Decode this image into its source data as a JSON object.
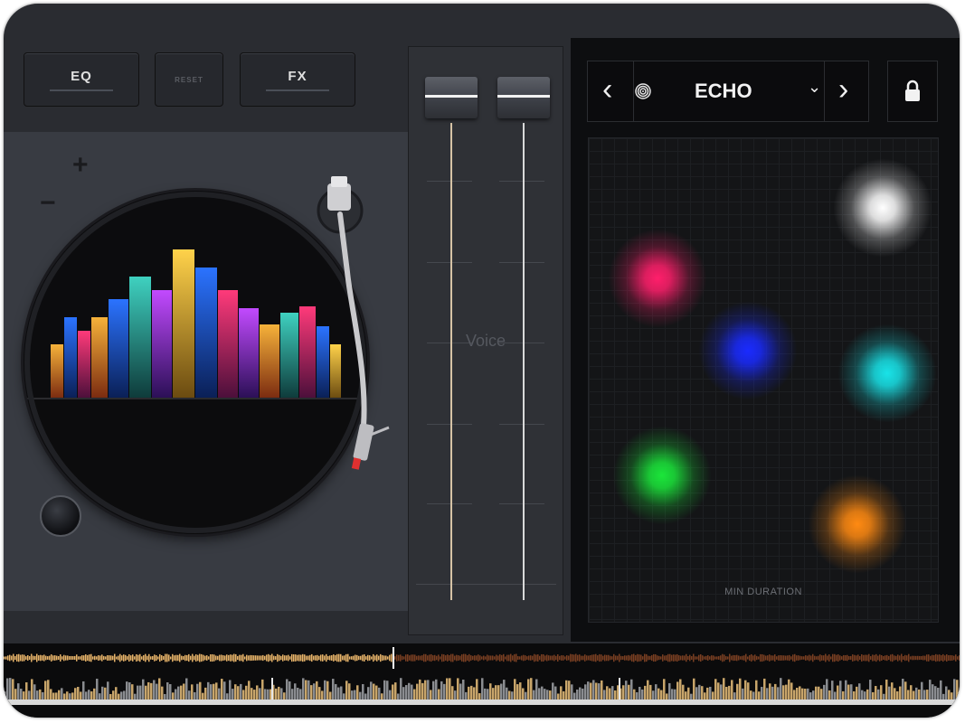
{
  "toolbar": {
    "eq_label": "EQ",
    "reset_label": "RESET",
    "fx_label": "FX"
  },
  "turntable": {
    "zoom_in_label": "+",
    "zoom_out_label": "−"
  },
  "mixer": {
    "voice_label": "Voice"
  },
  "fx": {
    "selected_effect": "ECHO",
    "pad_label": "MIN DURATION",
    "prev_glyph": "‹",
    "next_glyph": "›",
    "dropdown_glyph": "⌄"
  },
  "colors": {
    "background": "#2a2c31",
    "fx_panel": "#0d0e10",
    "pad_white": "#ffffff",
    "pad_pink": "#ff1f6b",
    "pad_blue": "#1a2bff",
    "pad_cyan": "#19e3e8",
    "pad_green": "#1be63a",
    "pad_orange": "#ff8a12",
    "waveform_left": "#e8b46a",
    "waveform_right": "#7a3f22"
  },
  "icons": [
    "fingerprint-icon",
    "lock-icon",
    "chevron-left-icon",
    "chevron-right-icon",
    "chevron-down-icon",
    "tonearm-icon"
  ]
}
